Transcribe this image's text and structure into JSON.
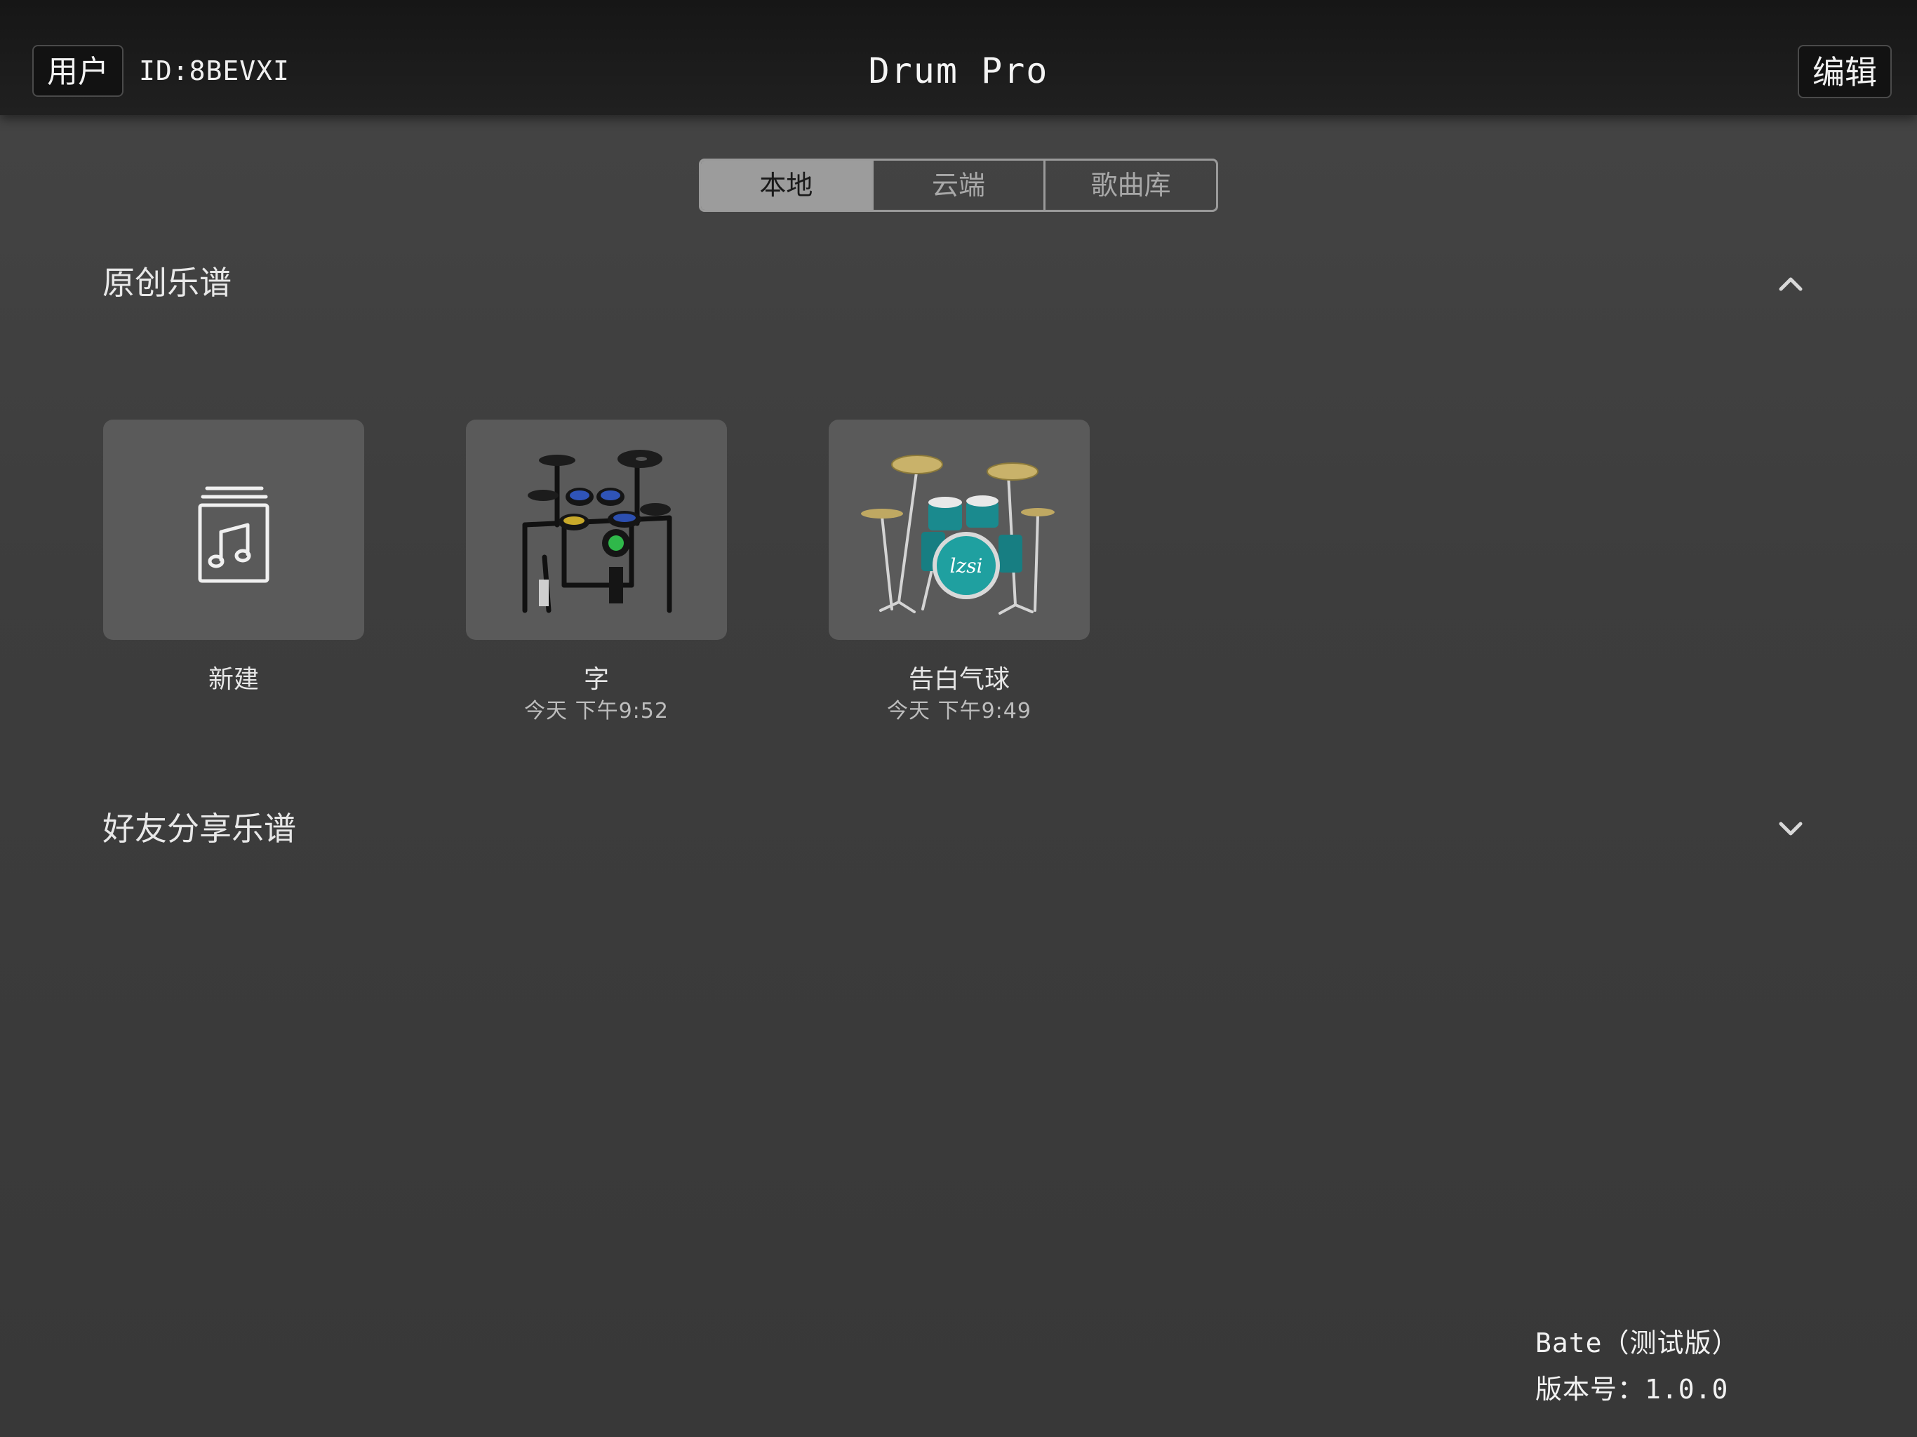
{
  "header": {
    "user_label": "用户",
    "user_id": "ID:8BEVXI",
    "title": "Drum Pro",
    "edit_label": "编辑"
  },
  "tabs": [
    {
      "label": "本地",
      "active": true
    },
    {
      "label": "云端",
      "active": false
    },
    {
      "label": "歌曲库",
      "active": false
    }
  ],
  "sections": {
    "original": {
      "title": "原创乐谱",
      "expanded": true,
      "icon": "chevron-up-icon"
    },
    "shared": {
      "title": "好友分享乐谱",
      "expanded": false,
      "icon": "chevron-down-icon"
    }
  },
  "cards": [
    {
      "label": "新建",
      "date": "",
      "icon": "music-file-icon"
    },
    {
      "label": "字",
      "date": "今天 下午9:52",
      "icon": "electronic-drum-kit-image"
    },
    {
      "label": "告白气球",
      "date": "今天 下午9:49",
      "icon": "acoustic-drum-kit-image"
    }
  ],
  "footer": {
    "build": "Bate（测试版）",
    "version": "版本号：1.0.0"
  },
  "colors": {
    "background": "#3d3d3d",
    "header": "#1c1c1c",
    "card": "#5a5a5a",
    "tab_active": "#9c9c9c",
    "drum_teal": "#1fa0a0",
    "cymbal_gold": "#c9b26a"
  }
}
